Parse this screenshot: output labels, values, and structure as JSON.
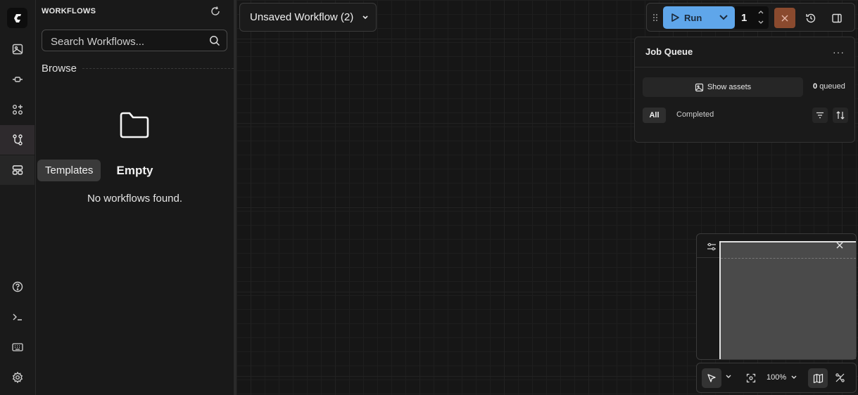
{
  "sidebar": {
    "header": "WORKFLOWS",
    "search_placeholder": "Search Workflows...",
    "browse_label": "Browse",
    "empty_title": "Empty",
    "empty_message": "No workflows found."
  },
  "rail": {
    "items": [
      {
        "icon": "image-assets-icon"
      },
      {
        "icon": "nodes-icon"
      },
      {
        "icon": "node-library-icon"
      },
      {
        "icon": "workflows-icon",
        "active": true
      },
      {
        "icon": "templates-icon",
        "hover": true
      },
      {
        "icon": "help-icon"
      },
      {
        "icon": "terminal-icon"
      },
      {
        "icon": "keyboard-icon"
      },
      {
        "icon": "settings-icon"
      }
    ],
    "tooltip": "Templates"
  },
  "workflow_tab": {
    "title": "Unsaved Workflow (2)"
  },
  "toolbar": {
    "run_label": "Run",
    "batch_count": "1",
    "colors": {
      "run": "#5fa6ea",
      "cancel": "#8a4a2e"
    }
  },
  "queue": {
    "title": "Job Queue",
    "show_assets": "Show assets",
    "queued_count": "0",
    "queued_label": "queued",
    "filters": [
      "All",
      "Completed"
    ]
  },
  "canvas_controls": {
    "zoom": "100%"
  }
}
